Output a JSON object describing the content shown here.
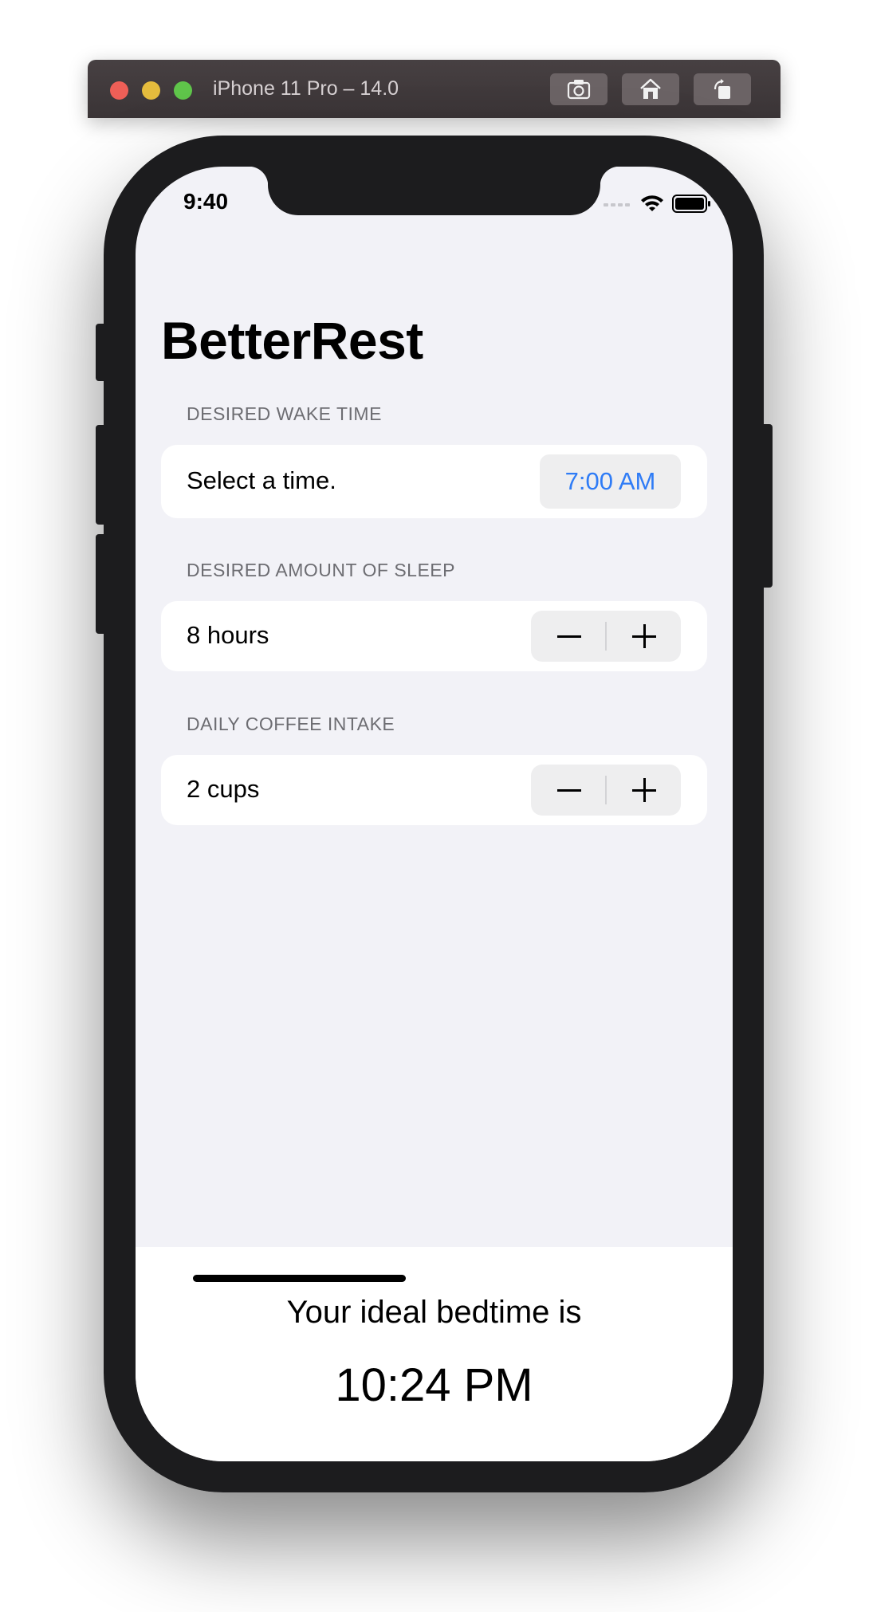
{
  "simulator": {
    "title": "iPhone 11 Pro – 14.0",
    "buttons": [
      "screenshot-icon",
      "home-icon",
      "rotate-icon"
    ]
  },
  "status_bar": {
    "time": "9:40"
  },
  "app": {
    "title": "BetterRest",
    "sections": {
      "wake": {
        "header": "DESIRED WAKE TIME",
        "label": "Select a time.",
        "value": "7:00 AM"
      },
      "sleep": {
        "header": "DESIRED AMOUNT OF SLEEP",
        "label": "8 hours"
      },
      "coffee": {
        "header": "DAILY COFFEE INTAKE",
        "label": "2 cups"
      }
    },
    "result": {
      "label": "Your ideal bedtime is",
      "value": "10:24 PM"
    }
  },
  "colors": {
    "accent": "#2f7cf6",
    "background": "#f2f2f7",
    "cell": "#ffffff"
  }
}
